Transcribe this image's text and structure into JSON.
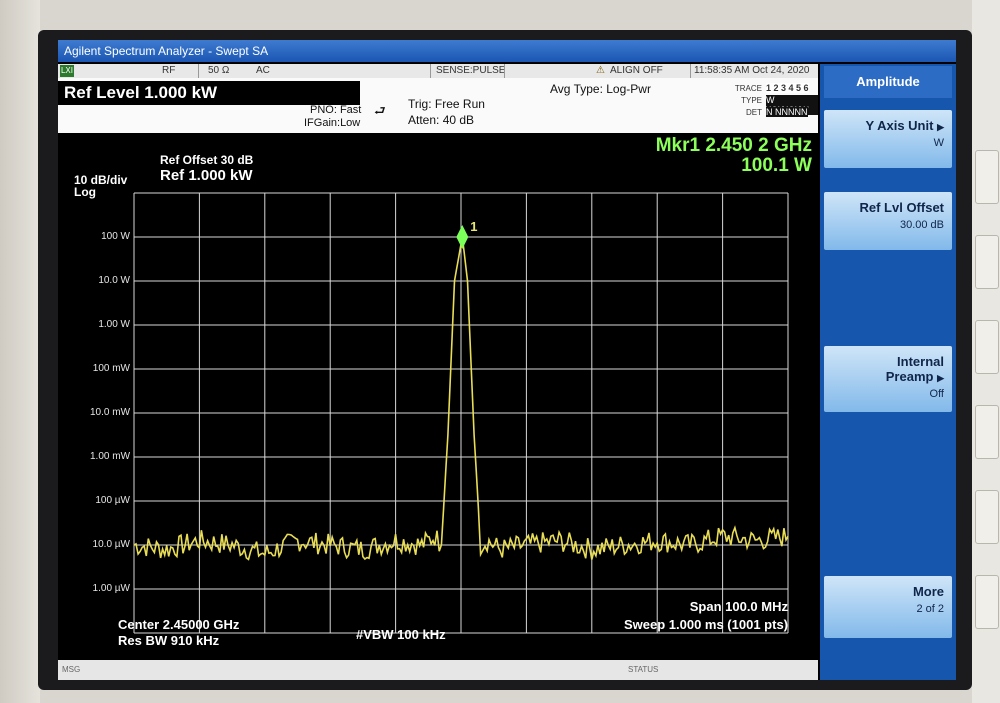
{
  "window": {
    "title": "Agilent Spectrum Analyzer - Swept SA"
  },
  "status_bar": {
    "lxi": "LXI",
    "rf": "RF",
    "impedance": "50 Ω",
    "coupling": "AC",
    "sense": "SENSE:PULSE",
    "align": "ALIGN OFF",
    "datetime": "11:58:35 AM Oct 24, 2020"
  },
  "settings": {
    "ref_level": "Ref Level 1.000 kW",
    "pno": "PNO: Fast",
    "ifgain": "IFGain:Low",
    "trig": "Trig: Free Run",
    "atten": "Atten: 40 dB",
    "avg_type": "Avg Type: Log-Pwr",
    "trace_label": "TRACE",
    "trace_numbers": "1 2 3 4 5 6",
    "type_label": "TYPE",
    "type_values": "W WWWWW",
    "det_label": "DET",
    "det_values": "N NNNNN"
  },
  "display": {
    "scale_per_div": "10 dB/div",
    "scale_type": "Log",
    "ref_offset": "Ref Offset 30 dB",
    "ref_value": "Ref 1.000 kW",
    "marker_freq": "Mkr1 2.450 2 GHz",
    "marker_amp": "100.1 W",
    "marker_label": "1",
    "center": "Center 2.45000 GHz",
    "res_bw": "Res BW 910 kHz",
    "vbw": "#VBW 100 kHz",
    "span": "Span 100.0 MHz",
    "sweep": "Sweep  1.000 ms (1001 pts)",
    "msg": "MSG",
    "status": "STATUS"
  },
  "softkeys": {
    "menu_title": "Amplitude",
    "y_axis_unit": "Y Axis Unit",
    "y_axis_unit_value": "W",
    "ref_lvl_offset": "Ref Lvl Offset",
    "ref_lvl_offset_value": "30.00 dB",
    "internal_preamp_1": "Internal",
    "internal_preamp_2": "Preamp",
    "internal_preamp_value": "Off",
    "more": "More",
    "more_page": "2 of 2"
  },
  "chart_data": {
    "type": "line",
    "x_range_ghz": [
      2.4,
      2.5
    ],
    "y_unit": "dBm",
    "y_range_dbm": [
      -40,
      60
    ],
    "tick_labels": [
      "100 W",
      "10.0 W",
      "1.00 W",
      "100 mW",
      "10.0 mW",
      "1.00 mW",
      "100 µW",
      "10.0 µW",
      "1.00 µW"
    ],
    "tick_values_dbm": [
      50,
      40,
      30,
      20,
      10,
      0,
      -10,
      -20,
      -30
    ],
    "series": [
      {
        "x": [
          2.4,
          2.405,
          2.41,
          2.415,
          2.42,
          2.425,
          2.43,
          2.435,
          2.44,
          2.444,
          2.446,
          2.447,
          2.448,
          2.449,
          2.4502,
          2.451,
          2.452,
          2.453,
          2.454,
          2.456,
          2.46,
          2.465,
          2.47,
          2.475,
          2.48,
          2.485,
          2.49,
          2.495,
          2.5
        ],
        "y": [
          -20,
          -21,
          -19,
          -20,
          -22,
          -19,
          -20,
          -21,
          -19,
          -20,
          -18,
          -20,
          5,
          40,
          50,
          40,
          5,
          -20,
          -19,
          -21,
          -20,
          -19,
          -21,
          -20,
          -19,
          -20,
          -18,
          -19,
          -18
        ]
      }
    ],
    "marker": {
      "x": 2.4502,
      "y": 50.0,
      "label": "1"
    },
    "colors": {
      "trace": "#e8dd55",
      "grid": "#d8d8d8",
      "marker": "#7dff5a",
      "background": "#000000"
    }
  }
}
